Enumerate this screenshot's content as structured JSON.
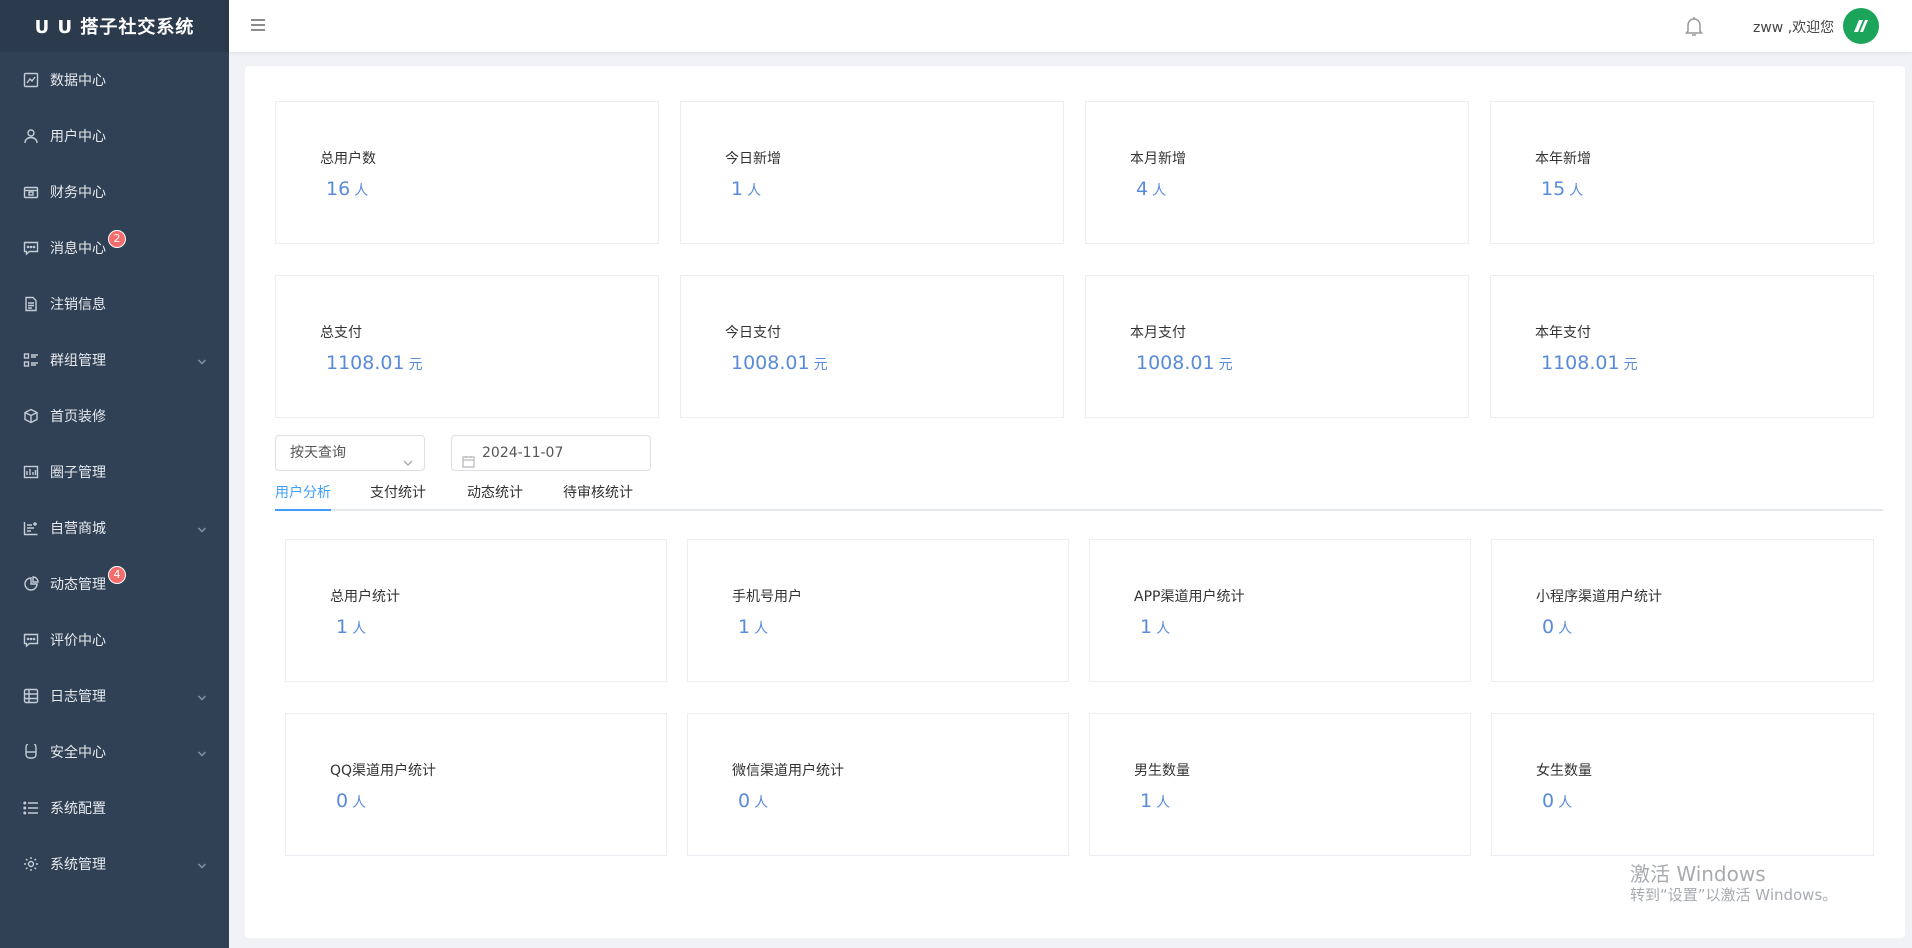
{
  "app": {
    "title": "U U 搭子社交系统"
  },
  "sidebar": {
    "items": [
      {
        "label": "数据中心",
        "icon": "chart-icon",
        "badge": null,
        "expandable": false
      },
      {
        "label": "用户中心",
        "icon": "user-icon",
        "badge": null,
        "expandable": false
      },
      {
        "label": "财务中心",
        "icon": "wallet-icon",
        "badge": null,
        "expandable": false
      },
      {
        "label": "消息中心",
        "icon": "message-icon",
        "badge": "2",
        "expandable": false
      },
      {
        "label": "注销信息",
        "icon": "document-icon",
        "badge": null,
        "expandable": false
      },
      {
        "label": "群组管理",
        "icon": "list-icon",
        "badge": null,
        "expandable": true
      },
      {
        "label": "首页装修",
        "icon": "box-icon",
        "badge": null,
        "expandable": false
      },
      {
        "label": "圈子管理",
        "icon": "image-icon",
        "badge": null,
        "expandable": false
      },
      {
        "label": "自营商城",
        "icon": "shop-icon",
        "badge": null,
        "expandable": true
      },
      {
        "label": "动态管理",
        "icon": "pie-icon",
        "badge": "4",
        "expandable": false
      },
      {
        "label": "评价中心",
        "icon": "comment-icon",
        "badge": null,
        "expandable": false
      },
      {
        "label": "日志管理",
        "icon": "grid-icon",
        "badge": null,
        "expandable": true
      },
      {
        "label": "安全中心",
        "icon": "lock-icon",
        "badge": null,
        "expandable": true
      },
      {
        "label": "系统配置",
        "icon": "menu-list-icon",
        "badge": null,
        "expandable": false
      },
      {
        "label": "系统管理",
        "icon": "gear-icon",
        "badge": null,
        "expandable": true
      }
    ]
  },
  "header": {
    "welcome": "zww ,欢迎您",
    "icons": {
      "menu": "hamburger-icon",
      "notify": "bell-icon",
      "avatar": "avatar-logo"
    }
  },
  "stats": {
    "users": [
      {
        "label": "总用户数",
        "value": "16",
        "unit": "人"
      },
      {
        "label": "今日新增",
        "value": "1",
        "unit": "人"
      },
      {
        "label": "本月新增",
        "value": "4",
        "unit": "人"
      },
      {
        "label": "本年新增",
        "value": "15",
        "unit": "人"
      }
    ],
    "payments": [
      {
        "label": "总支付",
        "value": "1108.01",
        "unit": "元"
      },
      {
        "label": "今日支付",
        "value": "1008.01",
        "unit": "元"
      },
      {
        "label": "本月支付",
        "value": "1008.01",
        "unit": "元"
      },
      {
        "label": "本年支付",
        "value": "1108.01",
        "unit": "元"
      }
    ]
  },
  "filters": {
    "query_mode": "按天查询",
    "date": "2024-11-07"
  },
  "tabs": [
    {
      "label": "用户分析",
      "active": true
    },
    {
      "label": "支付统计",
      "active": false
    },
    {
      "label": "动态统计",
      "active": false
    },
    {
      "label": "待审核统计",
      "active": false
    }
  ],
  "user_analysis": [
    {
      "label": "总用户统计",
      "value": "1",
      "unit": "人"
    },
    {
      "label": "手机号用户",
      "value": "1",
      "unit": "人"
    },
    {
      "label": "APP渠道用户统计",
      "value": "1",
      "unit": "人"
    },
    {
      "label": "小程序渠道用户统计",
      "value": "0",
      "unit": "人"
    },
    {
      "label": "QQ渠道用户统计",
      "value": "0",
      "unit": "人"
    },
    {
      "label": "微信渠道用户统计",
      "value": "0",
      "unit": "人"
    },
    {
      "label": "男生数量",
      "value": "1",
      "unit": "人"
    },
    {
      "label": "女生数量",
      "value": "0",
      "unit": "人"
    }
  ],
  "watermark": {
    "line1": "激活 Windows",
    "line2": "转到“设置”以激活 Windows。"
  },
  "colors": {
    "sidebar_bg": "#304156",
    "accent": "#409eff",
    "value_text": "#5a8bd8",
    "badge": "#f56c6c",
    "avatar_bg": "#1aa55a"
  }
}
